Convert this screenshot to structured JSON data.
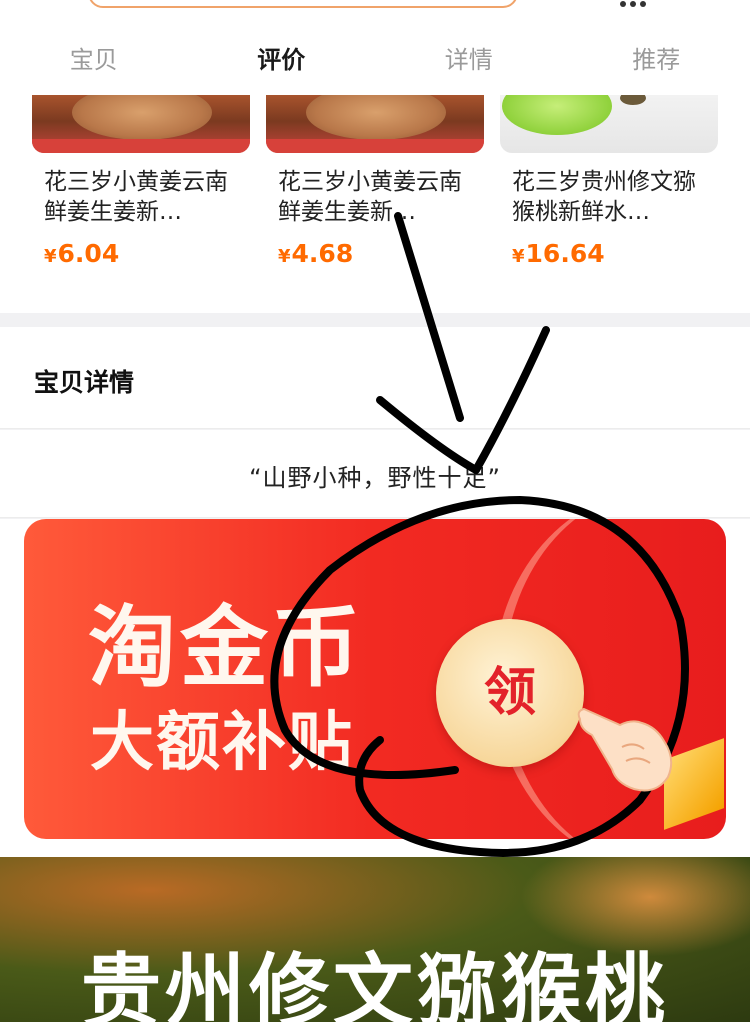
{
  "tabs": [
    {
      "label": "宝贝"
    },
    {
      "label": "评价"
    },
    {
      "label": "详情"
    },
    {
      "label": "推荐"
    }
  ],
  "active_tab": "评价",
  "recommendations": [
    {
      "title": "花三岁小黄姜云南鲜姜生姜新…",
      "currency": "¥",
      "price": "6.04",
      "image": "ginger"
    },
    {
      "title": "花三岁小黄姜云南鲜姜生姜新…",
      "currency": "¥",
      "price": "4.68",
      "image": "ginger"
    },
    {
      "title": "花三岁贵州修文猕猴桃新鲜水…",
      "currency": "¥",
      "price": "16.64",
      "image": "kiwi"
    }
  ],
  "detail_section": {
    "title": "宝贝详情"
  },
  "slogan": "“山野小种，野性十足”",
  "banner": {
    "title_line1": "淘金币",
    "title_line2": "大额补贴",
    "claim_label": "领"
  },
  "hero": {
    "title": "贵州修文猕猴桃"
  },
  "colors": {
    "price": "#ff6a00",
    "banner_red": "#f22a22",
    "claim_text": "#e3222a"
  }
}
